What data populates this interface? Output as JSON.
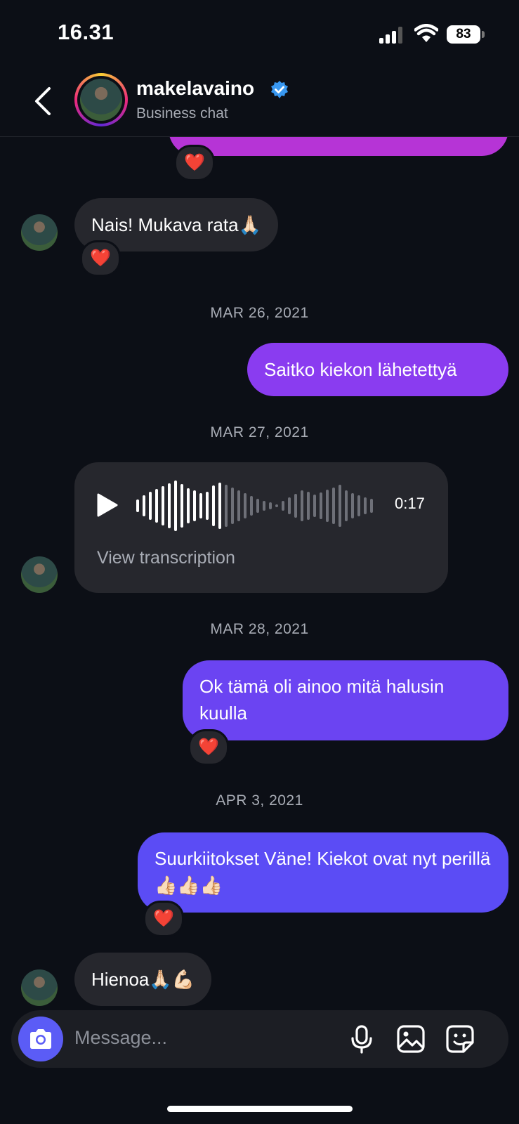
{
  "status_bar": {
    "time": "16.31",
    "battery": "83"
  },
  "header": {
    "username": "makelavaino",
    "subtitle": "Business chat"
  },
  "messages": [
    {
      "from": "them",
      "text": "Nais! Mukava rata🙏🏻",
      "reaction": "❤️"
    },
    {
      "date": "MAR 26, 2021"
    },
    {
      "from": "me",
      "text": "Saitko kiekon lähetettyä"
    },
    {
      "date": "MAR 27, 2021"
    },
    {
      "from": "them",
      "type": "voice",
      "duration": "0:17",
      "transcription_link": "View transcription"
    },
    {
      "date": "MAR 28, 2021"
    },
    {
      "from": "me",
      "text": "Ok tämä oli ainoo mitä halusin kuulla",
      "reaction": "❤️"
    },
    {
      "date": "APR 3, 2021"
    },
    {
      "from": "me",
      "text": "Suurkiitokset Väne! Kiekot ovat nyt perillä👍🏻👍🏻👍🏻",
      "reaction": "❤️"
    },
    {
      "from": "them",
      "text": "Hienoa🙏🏻💪🏻"
    }
  ],
  "top_reaction": "❤️",
  "composer": {
    "placeholder": "Message..."
  },
  "colors": {
    "background": "#0c0f16",
    "incoming": "#26272d",
    "outgoing_top": "#b634d6",
    "outgoing_bottom": "#5b4cf5",
    "accent": "#5b5cf6"
  },
  "icons": [
    "back-arrow-icon",
    "verified-badge-icon",
    "play-icon",
    "camera-icon",
    "microphone-icon",
    "gallery-icon",
    "sticker-icon",
    "heart-icon"
  ]
}
